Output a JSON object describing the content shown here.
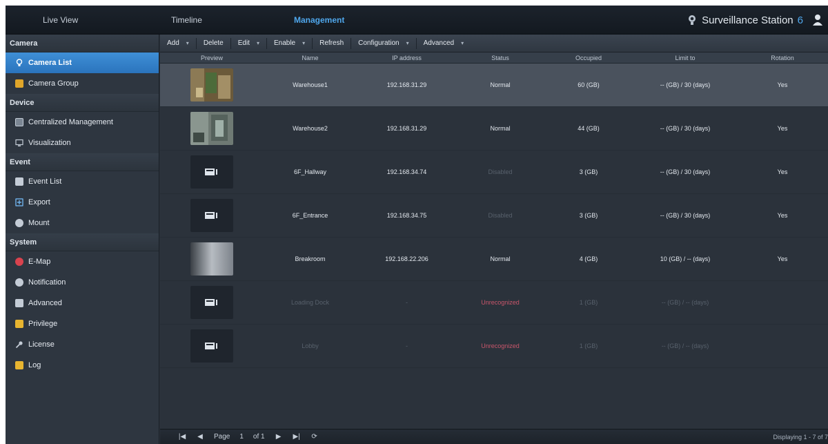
{
  "topbar": {
    "tabs": [
      {
        "label": "Live View"
      },
      {
        "label": "Timeline"
      },
      {
        "label": "Management"
      }
    ],
    "brand": {
      "name": "Surveillance Station",
      "version": "6"
    },
    "active_color": "#4fa7ec"
  },
  "sidebar": {
    "sections": [
      {
        "title": "Camera",
        "items": [
          {
            "label": "Camera List",
            "icon": "camera-icon",
            "active": true
          },
          {
            "label": "Camera Group",
            "icon": "folder-icon"
          }
        ]
      },
      {
        "title": "Device",
        "items": [
          {
            "label": "Centralized Management",
            "icon": "server-icon"
          },
          {
            "label": "Visualization",
            "icon": "monitor-icon"
          }
        ]
      },
      {
        "title": "Event",
        "items": [
          {
            "label": "Event List",
            "icon": "list-icon"
          },
          {
            "label": "Export",
            "icon": "export-icon"
          },
          {
            "label": "Mount",
            "icon": "mount-icon"
          }
        ]
      },
      {
        "title": "System",
        "items": [
          {
            "label": "E-Map",
            "icon": "emap-icon"
          },
          {
            "label": "Notification",
            "icon": "notification-icon"
          },
          {
            "label": "Advanced",
            "icon": "gear-icon"
          },
          {
            "label": "Privilege",
            "icon": "lock-icon"
          },
          {
            "label": "License",
            "icon": "key-icon"
          },
          {
            "label": "Log",
            "icon": "log-icon"
          }
        ]
      }
    ]
  },
  "toolbar": {
    "add": "Add",
    "delete": "Delete",
    "edit": "Edit",
    "enable": "Enable",
    "refresh": "Refresh",
    "configuration": "Configuration",
    "advanced": "Advanced"
  },
  "table": {
    "headers": {
      "preview": "Preview",
      "name": "Name",
      "ip": "IP address",
      "status": "Status",
      "occupied": "Occupied",
      "limit": "Limit to",
      "rotation": "Rotation"
    },
    "rows": [
      {
        "name": "Warehouse1",
        "ip": "192.168.31.29",
        "status": "Normal",
        "occupied": "60 (GB)",
        "limit": "-- (GB) / 30 (days)",
        "rotation": "Yes"
      },
      {
        "name": "Warehouse2",
        "ip": "192.168.31.29",
        "status": "Normal",
        "occupied": "44 (GB)",
        "limit": "-- (GB) / 30 (days)",
        "rotation": "Yes"
      },
      {
        "name": "6F_Hallway",
        "ip": "192.168.34.74",
        "status": "Disabled",
        "occupied": "3 (GB)",
        "limit": "-- (GB) / 30 (days)",
        "rotation": "Yes"
      },
      {
        "name": "6F_Entrance",
        "ip": "192.168.34.75",
        "status": "Disabled",
        "occupied": "3 (GB)",
        "limit": "-- (GB) / 30 (days)",
        "rotation": "Yes"
      },
      {
        "name": "Breakroom",
        "ip": "192.168.22.206",
        "status": "Normal",
        "occupied": "4 (GB)",
        "limit": "10 (GB) / -- (days)",
        "rotation": "Yes"
      },
      {
        "name": "Loading Dock",
        "ip": "-",
        "status": "Unrecognized",
        "occupied": "1 (GB)",
        "limit": "-- (GB) / -- (days)",
        "rotation": ""
      },
      {
        "name": "Lobby",
        "ip": "-",
        "status": "Unrecognized",
        "occupied": "1 (GB)",
        "limit": "-- (GB) / -- (days)",
        "rotation": ""
      }
    ]
  },
  "pager": {
    "page_label": "Page",
    "page_value": "1",
    "of_label": "of 1",
    "display": "Displaying 1 - 7 of 7"
  }
}
